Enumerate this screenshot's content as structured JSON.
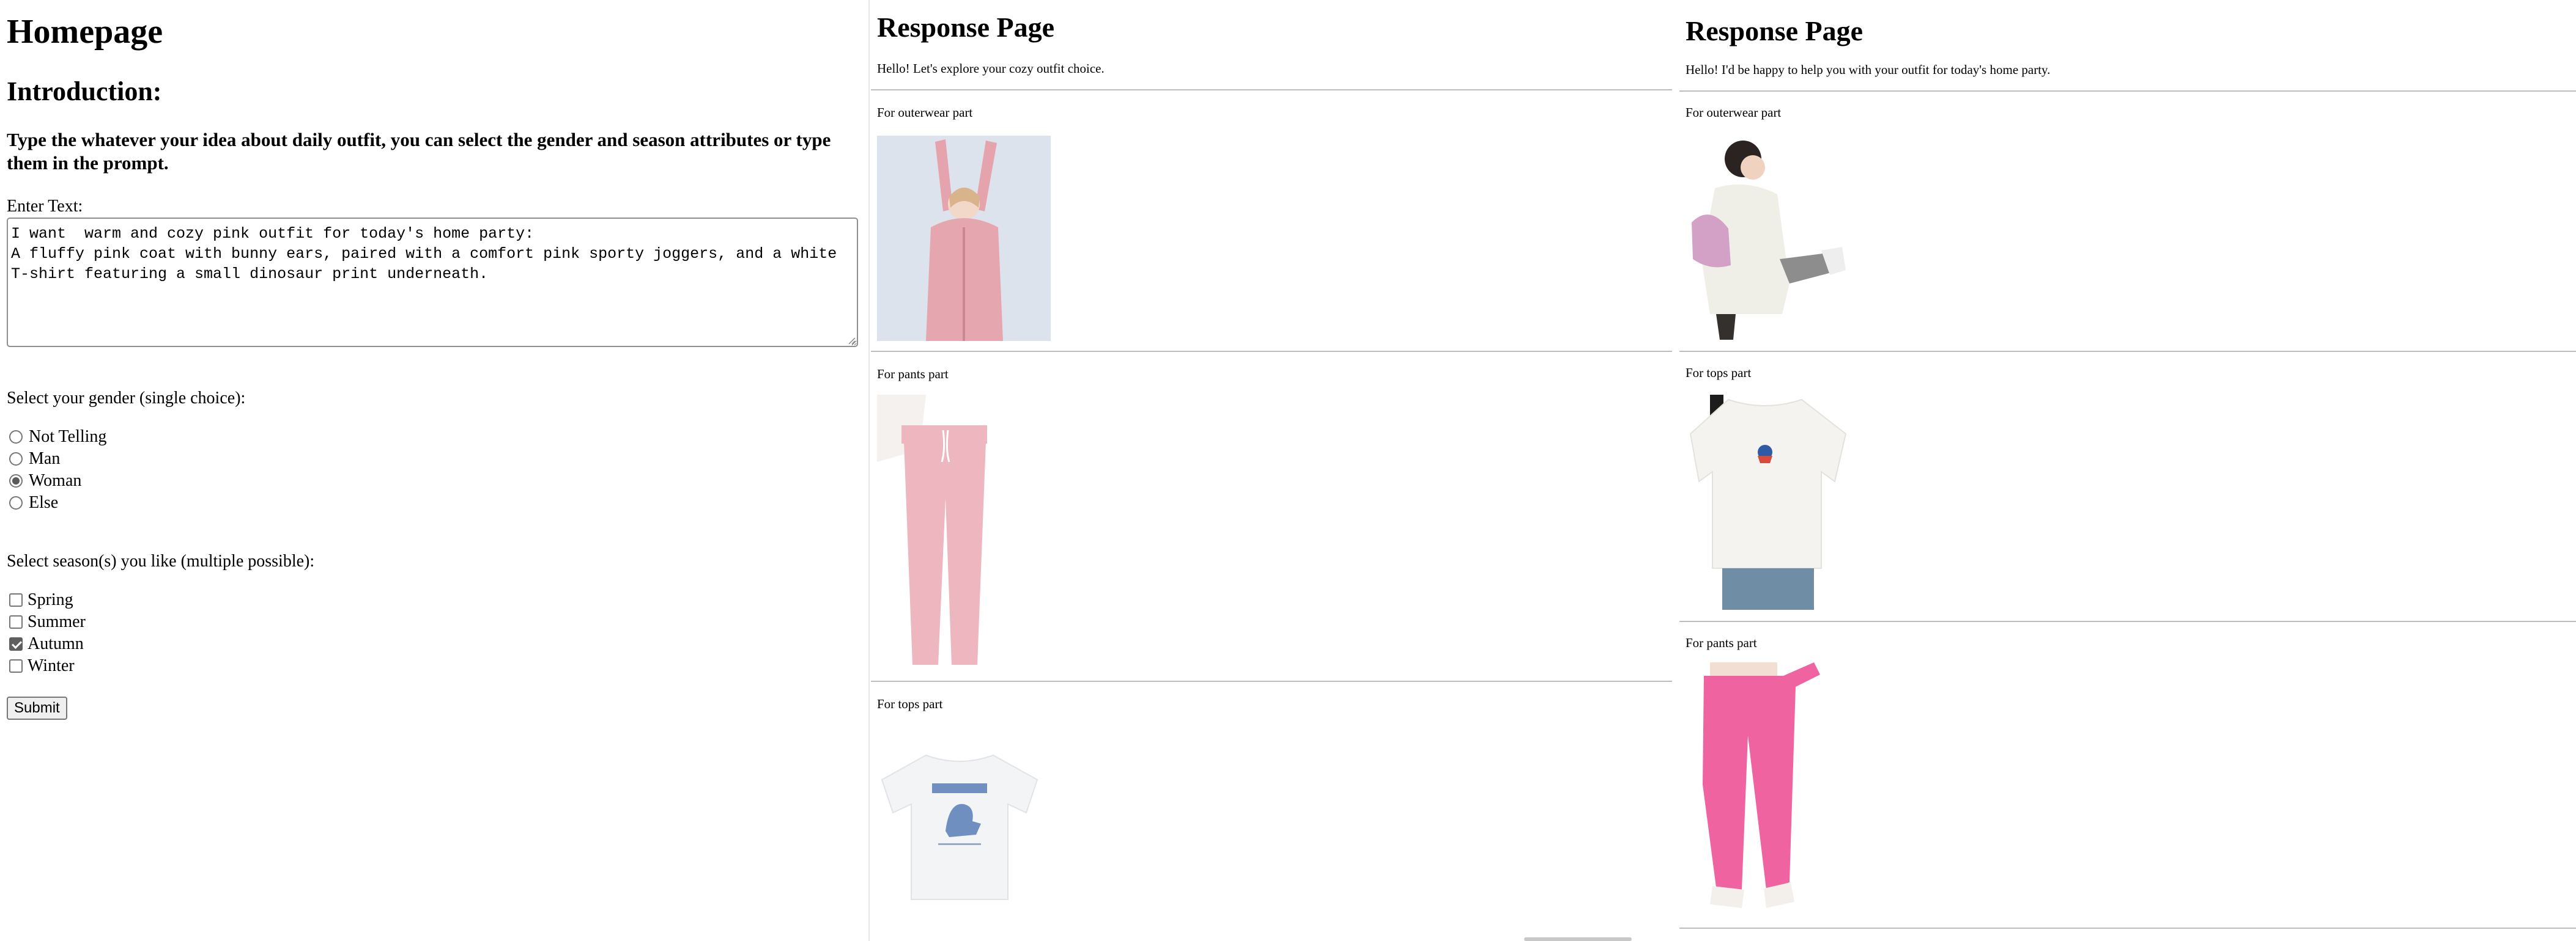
{
  "home": {
    "title": "Homepage",
    "intro_heading": "Introduction:",
    "intro_text": "Type the whatever your idea about daily outfit, you can select the gender and season attributes or type them in the prompt.",
    "text_label": "Enter Text:",
    "prompt_value": "I want  warm and cozy pink outfit for today's home party:\nA fluffy pink coat with bunny ears, paired with a comfort pink sporty joggers, and a white\nT-shirt featuring a small dinosaur print underneath.",
    "gender_label": "Select your gender (single choice):",
    "gender_options": [
      "Not Telling",
      "Man",
      "Woman",
      "Else"
    ],
    "gender_selected": "Woman",
    "season_label": "Select season(s) you like (multiple possible):",
    "season_options": [
      "Spring",
      "Summer",
      "Autumn",
      "Winter"
    ],
    "season_checked": [
      "Autumn"
    ],
    "submit_label": "Submit"
  },
  "response1": {
    "title": "Response Page",
    "greeting": "Hello! Let's explore your cozy outfit choice.",
    "parts": [
      {
        "label": "For outerwear part",
        "image": "pink-bunny-hoodie-photo"
      },
      {
        "label": "For pants part",
        "image": "light-pink-joggers-photo"
      },
      {
        "label": "For tops part",
        "image": "white-dinosaur-tshirt-photo"
      }
    ]
  },
  "response2": {
    "title": "Response Page",
    "greeting": "Hello! I'd be happy to help you with your outfit for today's home party.",
    "parts": [
      {
        "label": "For outerwear part",
        "image": "white-bunny-coat-photo"
      },
      {
        "label": "For tops part",
        "image": "white-dino-oversized-tee-photo"
      },
      {
        "label": "For pants part",
        "image": "hot-pink-joggers-photo"
      }
    ]
  },
  "colors": {
    "light_pink": "#e7a9b2",
    "hot_pink": "#f0609e",
    "radio_fill": "#5a5a5a",
    "divider": "#bdbdbd"
  }
}
